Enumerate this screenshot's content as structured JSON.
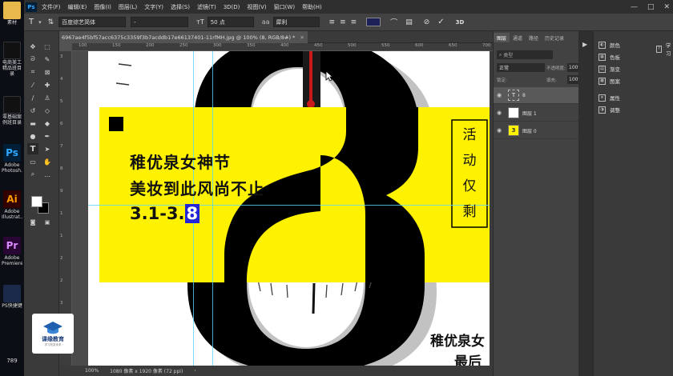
{
  "desktop": {
    "icons": [
      {
        "label": "素材",
        "color": "#e7b94a",
        "glyph": ""
      },
      {
        "label": "电商美工精品班目录",
        "color": "#1a1a1a",
        "glyph": ""
      },
      {
        "label": "零基础案例班目录",
        "color": "#1a1a1a",
        "glyph": ""
      },
      {
        "label": "Adobe Photosh...",
        "color": "#001e36",
        "glyph": "Ps"
      },
      {
        "label": "Adobe Illustrat...",
        "color": "#330000",
        "glyph": "Ai"
      },
      {
        "label": "Adobe Premiere...",
        "color": "#2a0634",
        "glyph": "Pr"
      },
      {
        "label": "PS快捷键",
        "color": "#1b2a4a",
        "glyph": ""
      }
    ],
    "corner_text": "789"
  },
  "menu": {
    "logo": "Ps",
    "items": [
      "文件(F)",
      "编辑(E)",
      "图像(I)",
      "图层(L)",
      "文字(Y)",
      "选择(S)",
      "滤镜(T)",
      "3D(D)",
      "视图(V)",
      "窗口(W)",
      "帮助(H)"
    ],
    "window_controls": [
      "—",
      "□",
      "✕"
    ]
  },
  "options": {
    "font_family": "百度综艺简体",
    "font_style": "-",
    "font_size": "50 点",
    "antialias": "犀利",
    "color": "#1e2158",
    "btn_3d": "3D"
  },
  "document": {
    "tab_title": "6967ae4f5bf57acc6375c3359f3b7acddb17e66137401-11rfMH.jpg @ 100% (8, RGB/8#) *",
    "status_zoom": "100%",
    "status_info": "1080 像素 x 1920 像素 (72 ppi)",
    "ruler_top": [
      "100",
      "150",
      "200",
      "250",
      "300",
      "350",
      "400",
      "450",
      "500",
      "550",
      "600",
      "650",
      "700"
    ],
    "ruler_left": [
      "3",
      "4",
      "5",
      "6",
      "7",
      "8",
      "9",
      "1",
      "1",
      "2",
      "2",
      "3",
      "4",
      "5"
    ]
  },
  "poster": {
    "big_digit": "8",
    "yellow": "#fff200",
    "headline": "稚优泉女神节",
    "subline": "美妆到此风尚不止",
    "date_prefix": "3.1-3.",
    "date_selected": "8",
    "side_badge_chars": [
      "活",
      "动",
      "仅",
      "剩"
    ],
    "bottom_line1": "稚优泉女",
    "bottom_line2": "最后"
  },
  "watermark": {
    "label": "课缘教育",
    "sub": "学习改变未来"
  },
  "layers_panel": {
    "tabs": [
      "图层",
      "通道",
      "路径",
      "历史记录"
    ],
    "filter_label": "类型",
    "blend_mode": "正常",
    "opacity_label": "不透明度:",
    "opacity_value": "100%",
    "lock_label": "锁定:",
    "fill_label": "填充:",
    "fill_value": "100%",
    "layers": [
      {
        "name": "8",
        "type": "T",
        "selected": true
      },
      {
        "name": "图层 1",
        "type": "img",
        "selected": false
      },
      {
        "name": "图层 0",
        "type": "img",
        "selected": false
      }
    ]
  },
  "adjust_panel": {
    "items": [
      "颜色",
      "色板",
      "渐变",
      "图案",
      "属性",
      "调整"
    ],
    "right_item": "学习"
  }
}
